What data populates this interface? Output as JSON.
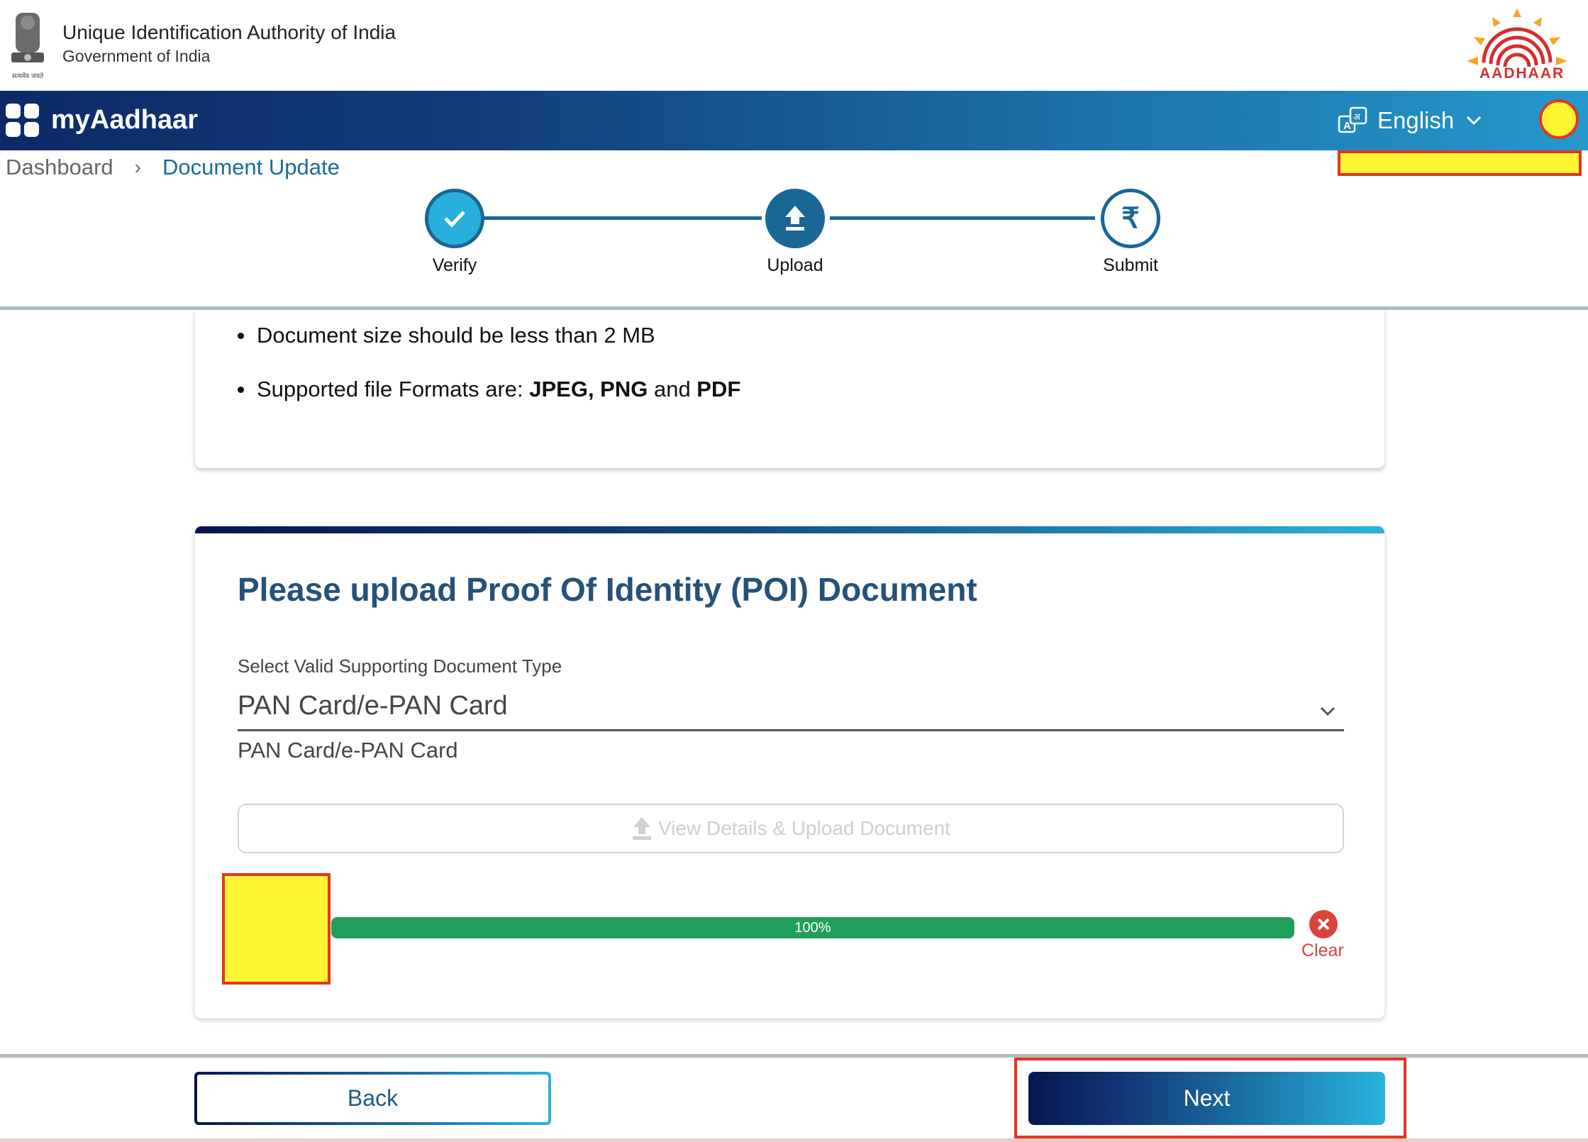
{
  "header": {
    "org_name": "Unique Identification Authority of India",
    "org_sub": "Government of India",
    "emblem_motto": "सत्यमेव जयते",
    "logo_text": "AADHAAR"
  },
  "nav": {
    "brand": "myAadhaar",
    "language": "English"
  },
  "breadcrumb": {
    "home": "Dashboard",
    "separator": "›",
    "current": "Document Update"
  },
  "stepper": {
    "steps": [
      {
        "label": "Verify",
        "state": "completed"
      },
      {
        "label": "Upload",
        "state": "active"
      },
      {
        "label": "Submit",
        "state": "pending"
      }
    ],
    "submit_glyph": "₹"
  },
  "rules": {
    "size": "Document size should be less than 2 MB",
    "formats_prefix": "Supported file Formats are: ",
    "format_a": "JPEG, PNG",
    "formats_and": " and ",
    "format_b": "PDF"
  },
  "upload_card": {
    "title": "Please upload Proof Of Identity (POI) Document",
    "select_label": "Select Valid Supporting Document Type",
    "select_value": "PAN Card/e-PAN Card",
    "selected_hint": "PAN Card/e-PAN Card",
    "upload_button": "View Details & Upload Document",
    "progress_percent": 100,
    "progress_label": "100%",
    "clear_label": "Clear"
  },
  "footer": {
    "back_label": "Back",
    "next_label": "Next"
  },
  "colors": {
    "brand_dark": "#0b2a66",
    "brand_light": "#2ab4de",
    "step_blue": "#1a6694",
    "progress_green": "#229e5c",
    "clear_red": "#d9433a",
    "title_blue": "#265179"
  }
}
